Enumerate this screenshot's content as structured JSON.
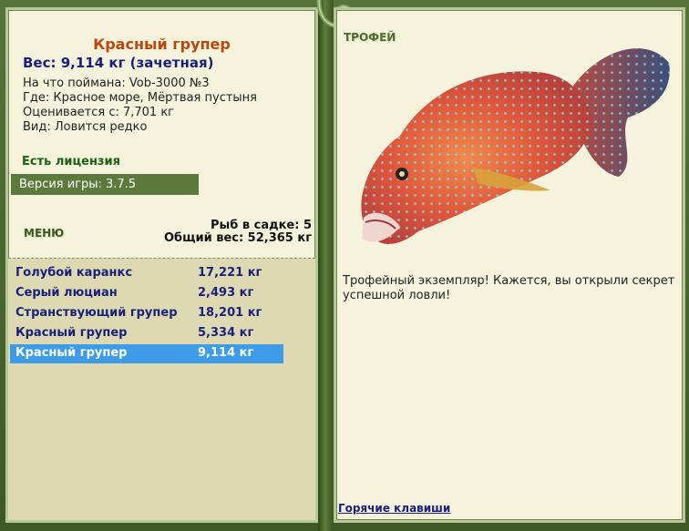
{
  "fish": {
    "name": "Красный групер",
    "weight_line": "Вес: 9,114 кг (зачетная)",
    "caught_on": "На что поймана: Vob-3000 №3",
    "location": "Где: Красное море, Мёртвая пустыня",
    "value": "Оценивается с: 7,701 кг",
    "rarity": "Вид: Ловится редко"
  },
  "license": "Есть лицензия",
  "version": "Версия игры: 3.7.5",
  "menu_label": "МЕНЮ",
  "keep": {
    "count_label": "Рыб в садке: 5",
    "total_label": "Общий вес: 52,365 кг"
  },
  "catch_list": [
    {
      "name": "Голубой каранкс",
      "weight": "17,221 кг"
    },
    {
      "name": "Серый люциан",
      "weight": "2,493 кг"
    },
    {
      "name": "Странствующий групер",
      "weight": "18,201 кг"
    },
    {
      "name": "Красный групер",
      "weight": "5,334 кг"
    },
    {
      "name": "Красный групер",
      "weight": "9,114 кг"
    }
  ],
  "trophy": {
    "label": "ТРОФЕЙ",
    "text": "Трофейный экземпляр! Кажется, вы открыли секрет успешной ловли!"
  },
  "hotkeys_label": "Горячие клавиши",
  "colors": {
    "selected_row": "#3d9be8",
    "panel_bg": "#f6f3dd",
    "frame": "#3f5a26"
  }
}
